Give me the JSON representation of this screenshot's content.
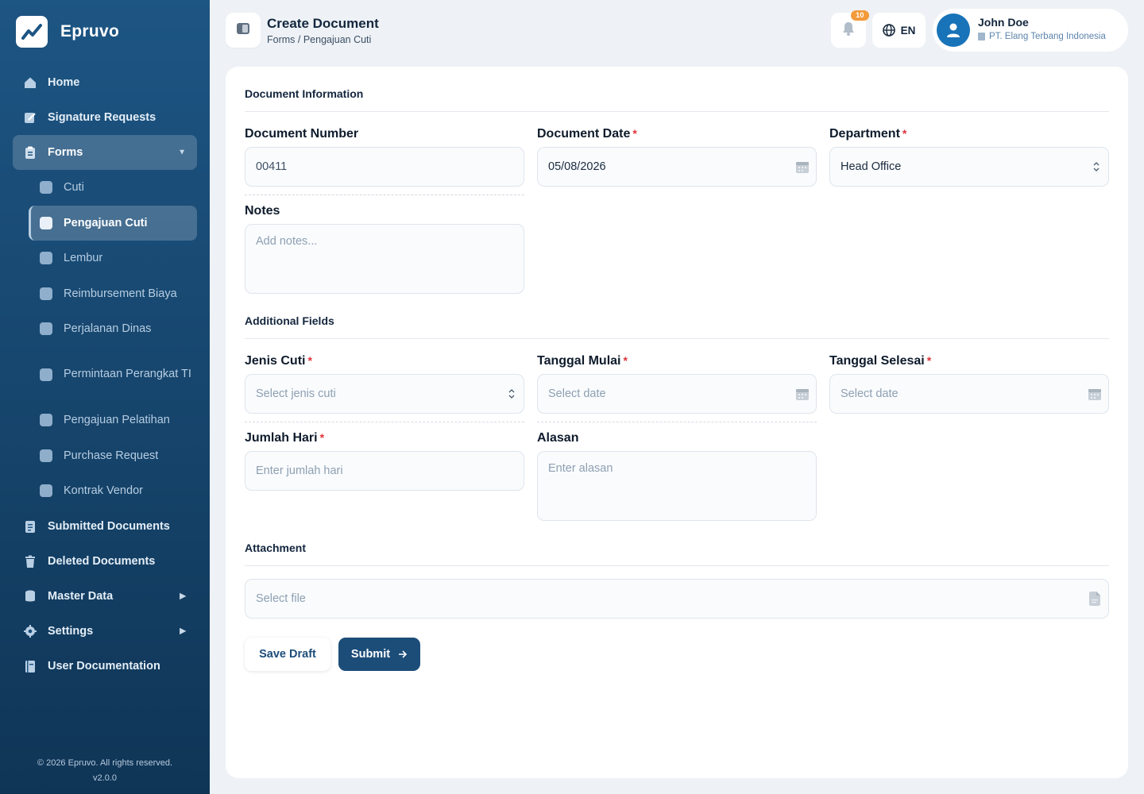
{
  "brand": {
    "name": "Epruvo",
    "logo_icon": "chart-trend-icon"
  },
  "sidebar": {
    "items": [
      {
        "label": "Home",
        "icon": "home-icon"
      },
      {
        "label": "Signature Requests",
        "icon": "signature-icon"
      },
      {
        "label": "Forms",
        "icon": "clipboard-icon",
        "expanded": true
      },
      {
        "label": "Submitted Documents",
        "icon": "document-icon"
      },
      {
        "label": "Deleted Documents",
        "icon": "trash-icon"
      },
      {
        "label": "Master Data",
        "icon": "database-icon"
      },
      {
        "label": "Settings",
        "icon": "gear-icon"
      },
      {
        "label": "User Documentation",
        "icon": "book-icon"
      }
    ],
    "forms_sub": [
      {
        "label": "Cuti"
      },
      {
        "label": "Pengajuan Cuti",
        "active": true
      },
      {
        "label": "Lembur"
      },
      {
        "label": "Reimbursement Biaya"
      },
      {
        "label": "Perjalanan Dinas"
      },
      {
        "label": "Permintaan Perangkat TI"
      },
      {
        "label": "Pengajuan Pelatihan"
      },
      {
        "label": "Purchase Request"
      },
      {
        "label": "Kontrak Vendor"
      }
    ],
    "footer_copyright": "© 2026 Epruvo. All rights reserved.",
    "footer_version": "v2.0.0"
  },
  "header": {
    "title": "Create Document",
    "breadcrumb": "Forms / Pengajuan Cuti",
    "notifications_count": "10",
    "language": "EN",
    "user_name": "John Doe",
    "user_company": "PT. Elang Terbang Indonesia"
  },
  "form": {
    "section_document_info": "Document Information",
    "document_number": {
      "label": "Document Number",
      "value": "00411"
    },
    "document_date": {
      "label": "Document Date",
      "value": "05/08/2026",
      "required": "*"
    },
    "department": {
      "label": "Department",
      "value": "Head Office",
      "required": "*"
    },
    "notes": {
      "label": "Notes",
      "placeholder": "Add notes..."
    },
    "section_additional": "Additional Fields",
    "jenis_cuti": {
      "label": "Jenis Cuti",
      "placeholder": "Select jenis cuti",
      "required": "*"
    },
    "tanggal_mulai": {
      "label": "Tanggal Mulai",
      "placeholder": "Select date",
      "required": "*"
    },
    "tanggal_selesai": {
      "label": "Tanggal Selesai",
      "placeholder": "Select date",
      "required": "*"
    },
    "jumlah_hari": {
      "label": "Jumlah Hari",
      "placeholder": "Enter jumlah hari",
      "required": "*"
    },
    "alasan": {
      "label": "Alasan",
      "placeholder": "Enter alasan"
    },
    "section_attachment": "Attachment",
    "attachment": {
      "placeholder": "Select file"
    },
    "save_draft_label": "Save Draft",
    "submit_label": "Submit"
  },
  "colors": {
    "sidebar": "#1d5583",
    "primary": "#1c4d79",
    "required": "#e0323a",
    "badge": "#f39a3a"
  }
}
